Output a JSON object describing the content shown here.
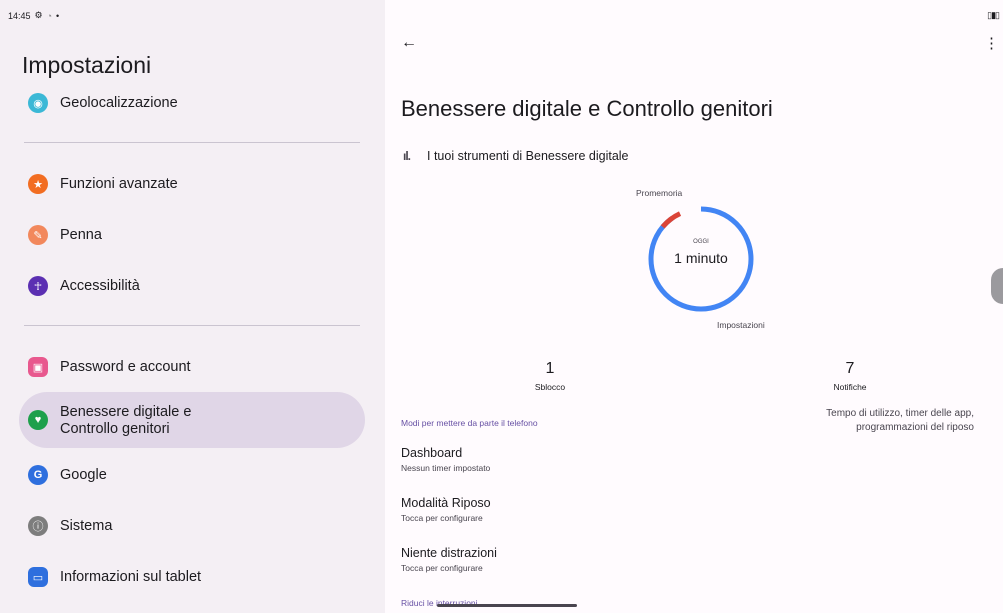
{
  "status": {
    "time": "14:45"
  },
  "settings": {
    "title": "Impostazioni",
    "items": [
      {
        "label": "Geolocalizzazione",
        "icon": "location-icon",
        "color": "#3bb8d6"
      },
      {
        "label": "Funzioni avanzate",
        "icon": "star-icon",
        "color": "#f26d21"
      },
      {
        "label": "Penna",
        "icon": "pen-icon",
        "color": "#f2885c"
      },
      {
        "label": "Accessibilità",
        "icon": "accessibility-icon",
        "color": "#5b2fb2"
      },
      {
        "label": "Password e account",
        "icon": "key-icon",
        "color": "#e8588e"
      },
      {
        "label": "Benessere digitale e Controllo genitori",
        "sublabel": "Tempo di utilizzo, timer delle app, programmazioni del riposo",
        "icon": "wellbeing-icon",
        "color": "#1ea04c"
      },
      {
        "label": "Google",
        "icon": "google-icon",
        "color": "#2e6fde"
      },
      {
        "label": "Sistema",
        "icon": "info-icon",
        "color": "#7d7d7d"
      },
      {
        "label": "Informazioni sul tablet",
        "icon": "tablet-icon",
        "color": "#2e6fde"
      }
    ]
  },
  "detail": {
    "title": "Benessere digitale e Controllo genitori",
    "tools_label": "I tuoi strumenti di Benessere digitale",
    "chart": {
      "top_label": "Promemoria",
      "bottom_label": "Impostazioni",
      "center_caption": "OGGI",
      "center_value": "1 minuto"
    },
    "stats": [
      {
        "value": "1",
        "label": "Sblocco"
      },
      {
        "value": "7",
        "label": "Notifiche"
      }
    ],
    "section1": "Modi per mettere da parte il telefono",
    "rows": [
      {
        "title": "Dashboard",
        "sub": "Nessun timer impostato"
      },
      {
        "title": "Modalità Riposo",
        "sub": "Tocca per configurare"
      },
      {
        "title": "Niente distrazioni",
        "sub": "Tocca per configurare"
      }
    ],
    "section2": "Riduci le interruzioni"
  }
}
